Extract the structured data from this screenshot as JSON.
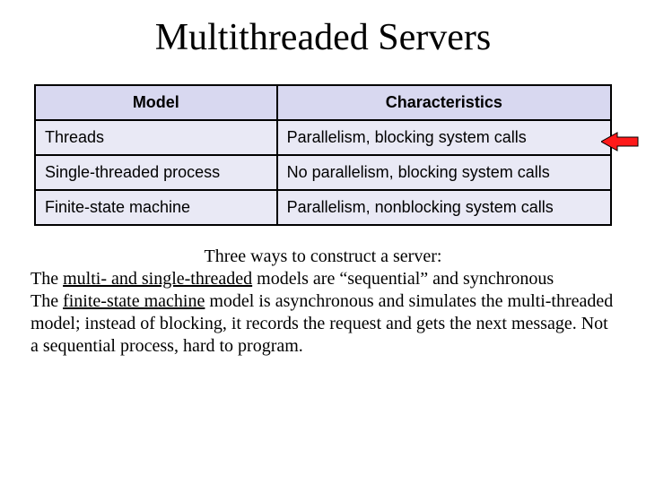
{
  "title": "Multithreaded Servers",
  "table": {
    "headers": {
      "model": "Model",
      "char": "Characteristics"
    },
    "rows": [
      {
        "model": "Threads",
        "char": "Parallelism, blocking system calls"
      },
      {
        "model": "Single-threaded process",
        "char": "No parallelism, blocking system calls"
      },
      {
        "model": "Finite-state machine",
        "char": "Parallelism, nonblocking system calls"
      }
    ]
  },
  "caption": {
    "lead": "Three ways to construct a server:",
    "line1a": "The ",
    "line1u": "multi- and single-threaded",
    "line1b": " models are “sequential” and synchronous",
    "line2a": "The ",
    "line2u": "finite-state machine",
    "line2b": " model is asynchronous and simulates the multi-threaded model; instead of blocking, it records the request and gets the next message. Not a sequential process, hard to program."
  }
}
